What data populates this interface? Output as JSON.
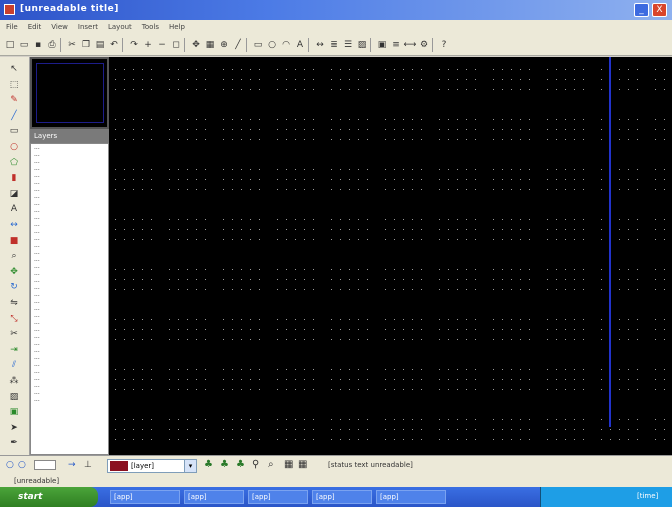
{
  "window": {
    "title": "[unreadable title]",
    "min_label": "_",
    "close_label": "X"
  },
  "menu": [
    "File",
    "Edit",
    "View",
    "Insert",
    "Layout",
    "Tools",
    "Help"
  ],
  "toolbar": {
    "buttons": [
      "new-icon",
      "open-icon",
      "save-icon",
      "print-icon",
      "cut-icon",
      "copy-icon",
      "paste-icon",
      "undo-icon",
      "redo-icon",
      "zoom-in-icon",
      "zoom-out-icon",
      "zoom-fit-icon",
      "pan-icon",
      "grid-icon",
      "snap-icon",
      "line-icon",
      "rect-icon",
      "circle-icon",
      "arc-icon",
      "text-icon",
      "dimension-icon",
      "layer-icon",
      "properties-icon",
      "hatch-icon",
      "block-icon",
      "align-icon",
      "measure-icon",
      "settings-icon",
      "help-icon"
    ]
  },
  "tools": [
    "pointer-icon",
    "select-icon",
    "pencil-icon",
    "line-icon",
    "rect-icon",
    "circle-icon",
    "polygon-icon",
    "fill-icon",
    "eraser-icon",
    "text-icon",
    "dimension-icon",
    "color-icon",
    "zoom-icon",
    "move-icon",
    "rotate-icon",
    "mirror-icon",
    "scale-icon",
    "trim-icon",
    "extend-icon",
    "offset-icon",
    "array-icon",
    "hatch-icon",
    "block-icon",
    "arrow-icon",
    "pen-icon"
  ],
  "layers": {
    "header": "Layers",
    "items": [
      "...",
      "...",
      "...",
      "...",
      "...",
      "...",
      "...",
      "...",
      "...",
      "...",
      "...",
      "...",
      "...",
      "...",
      "...",
      "...",
      "...",
      "...",
      "...",
      "...",
      "...",
      "...",
      "...",
      "...",
      "...",
      "...",
      "...",
      "...",
      "...",
      "...",
      "...",
      "...",
      "...",
      "...",
      "...",
      "...",
      "..."
    ]
  },
  "bottombar": {
    "layer_name": "[layer]",
    "status": "[status text unreadable]"
  },
  "statusline": {
    "text": "[unreadable]"
  },
  "taskbar": {
    "start": "start",
    "tasks": [
      "[app]",
      "[app]",
      "[app]",
      "[app]",
      "[app]"
    ],
    "clock": "[time]"
  },
  "colors": {
    "canvas": "#000000",
    "grid_dot": "#9a9a9a",
    "guide_line": "#2233cc",
    "layer_color": "#8b1020"
  }
}
